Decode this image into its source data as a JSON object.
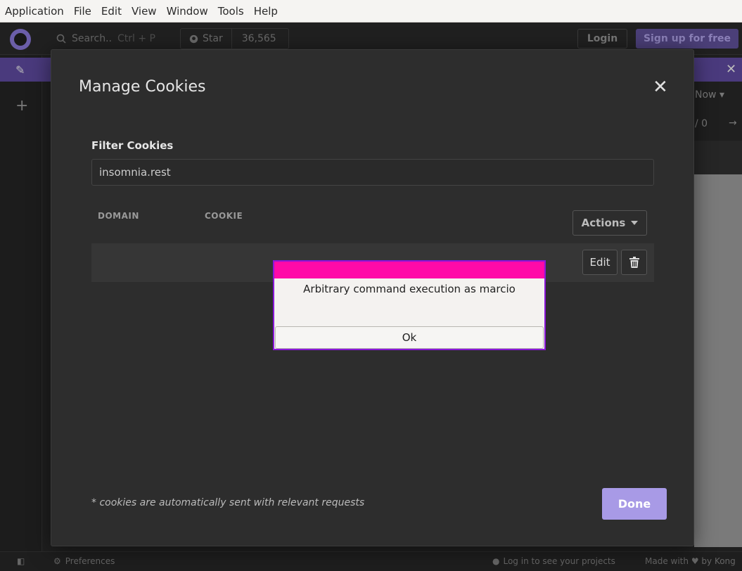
{
  "menubar": {
    "items": [
      "Application",
      "File",
      "Edit",
      "View",
      "Window",
      "Tools",
      "Help"
    ]
  },
  "header": {
    "search_placeholder": "Search..",
    "search_shortcut": "Ctrl + P",
    "star_label": "Star",
    "star_count": "36,565",
    "login_label": "Login",
    "signup_label": "Sign up for free"
  },
  "background": {
    "now_label": "Now",
    "pages_label": "/ 0",
    "arrow_label": "→"
  },
  "statusbar": {
    "preferences_label": "Preferences",
    "login_projects": "Log in to see your projects",
    "made_with_prefix": "Made with",
    "made_with_suffix": "by Kong"
  },
  "modal": {
    "title": "Manage Cookies",
    "filter_label": "Filter Cookies",
    "filter_value": "insomnia.rest",
    "columns": {
      "domain": "DOMAIN",
      "cookie": "COOKIE"
    },
    "actions_label": "Actions",
    "row": {
      "edit_label": "Edit"
    },
    "footnote": "* cookies are automatically sent with relevant requests",
    "done_label": "Done"
  },
  "alert": {
    "message": "Arbitrary command execution as marcio",
    "ok_label": "Ok",
    "titlebar_color": "#ff0aa8",
    "border_color": "#8a17d9"
  },
  "colors": {
    "accent": "#a89ae6",
    "purple_bar": "#4a3a7d"
  }
}
